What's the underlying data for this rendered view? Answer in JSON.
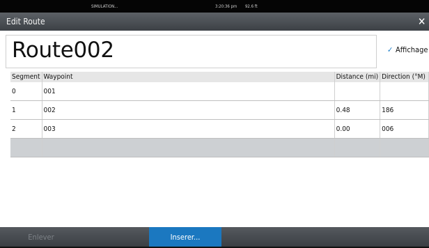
{
  "status_bar": {
    "mode": "SIMULATION...",
    "time": "3:20:36 pm",
    "depth": "92.6 ft"
  },
  "window": {
    "title": "Edit Route",
    "close_glyph": "✕"
  },
  "route": {
    "name": "Route002"
  },
  "display_option": {
    "label": "Affichage",
    "checked": true,
    "check_glyph": "✓"
  },
  "table": {
    "headers": [
      "Segment",
      "Waypoint",
      "Distance (mi)",
      "Direction (°M)"
    ],
    "rows": [
      [
        "0",
        "001",
        "",
        ""
      ],
      [
        "1",
        "002",
        "0.48",
        "186"
      ],
      [
        "2",
        "003",
        "0.00",
        "006"
      ],
      [
        "",
        "",
        "",
        ""
      ]
    ]
  },
  "buttons": {
    "remove": "Enlever",
    "insert": "Inserer..."
  }
}
